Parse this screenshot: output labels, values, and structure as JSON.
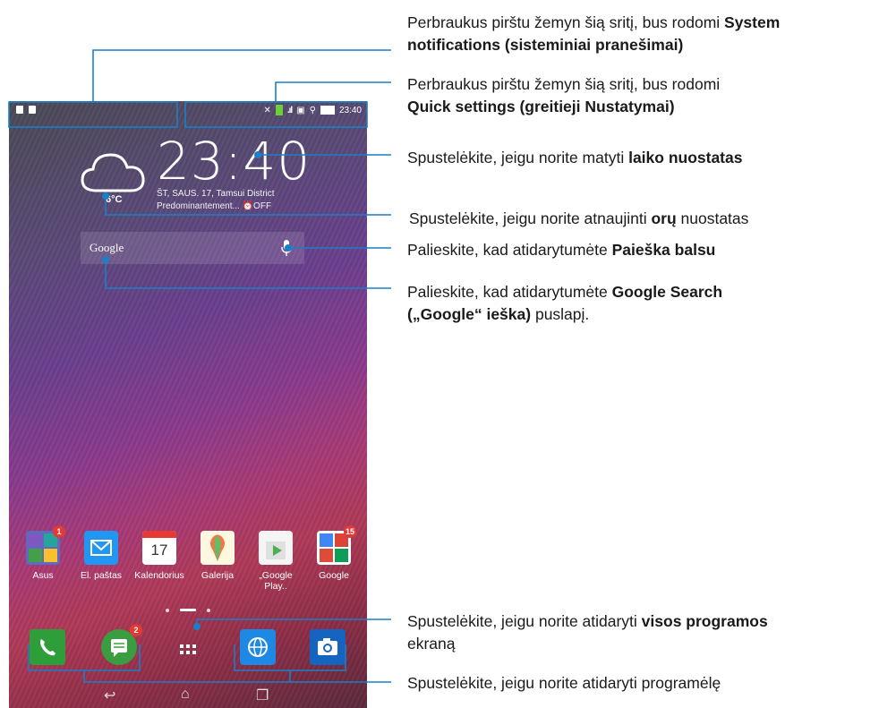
{
  "statusbar": {
    "time": "23:40"
  },
  "clock": {
    "time": "23:40",
    "date_line": "ŠT, SAUS. 17, Tamsui District",
    "weather_line": "Predominantement...  ⏰OFF",
    "temperature": "6°C"
  },
  "search": {
    "label": "Google"
  },
  "apps": [
    {
      "label": "Asus",
      "badge": "1",
      "icon": "asus-folder-icon"
    },
    {
      "label": "El. paštas",
      "badge": "",
      "icon": "email-icon"
    },
    {
      "label": "Kalendorius",
      "badge": "",
      "icon": "calendar-icon",
      "day": "17"
    },
    {
      "label": "Galerija",
      "badge": "",
      "icon": "gallery-icon"
    },
    {
      "label": "„Google Play..",
      "badge": "",
      "icon": "google-play-icon"
    },
    {
      "label": "Google",
      "badge": "15",
      "icon": "google-folder-icon"
    }
  ],
  "dock": {
    "messages_badge": "2"
  },
  "callouts": {
    "c1_plain": "Perbraukus pirštu žemyn šią sritį, bus rodomi ",
    "c1_bold": "System notifications (sisteminiai pranešimai)",
    "c2_plain": "Perbraukus pirštu žemyn šią sritį, bus rodomi",
    "c2_bold": "Quick settings (greitieji Nustatymai)",
    "c3_plain": "Spustelėkite, jeigu norite matyti ",
    "c3_bold": "laiko nuostatas",
    "c4_plain": "Spustelėkite, jeigu norite atnaujinti ",
    "c4_bold": "orų",
    "c4_tail": " nuostatas",
    "c5_plain": "Palieskite, kad atidarytumėte ",
    "c5_bold": "Paieška balsu",
    "c6_plain": "Palieskite, kad atidarytumėte ",
    "c6_bold": "Google Search („Google“ ieška)",
    "c6_tail": " puslapį.",
    "c7_plain": "Spustelėkite, jeigu norite atidaryti ",
    "c7_bold": "visos programos",
    "c7_tail": " ekraną",
    "c8_plain": "Spustelėkite, jeigu norite atidaryti programėlę"
  },
  "colors": {
    "callout": "#1a7fc9"
  }
}
